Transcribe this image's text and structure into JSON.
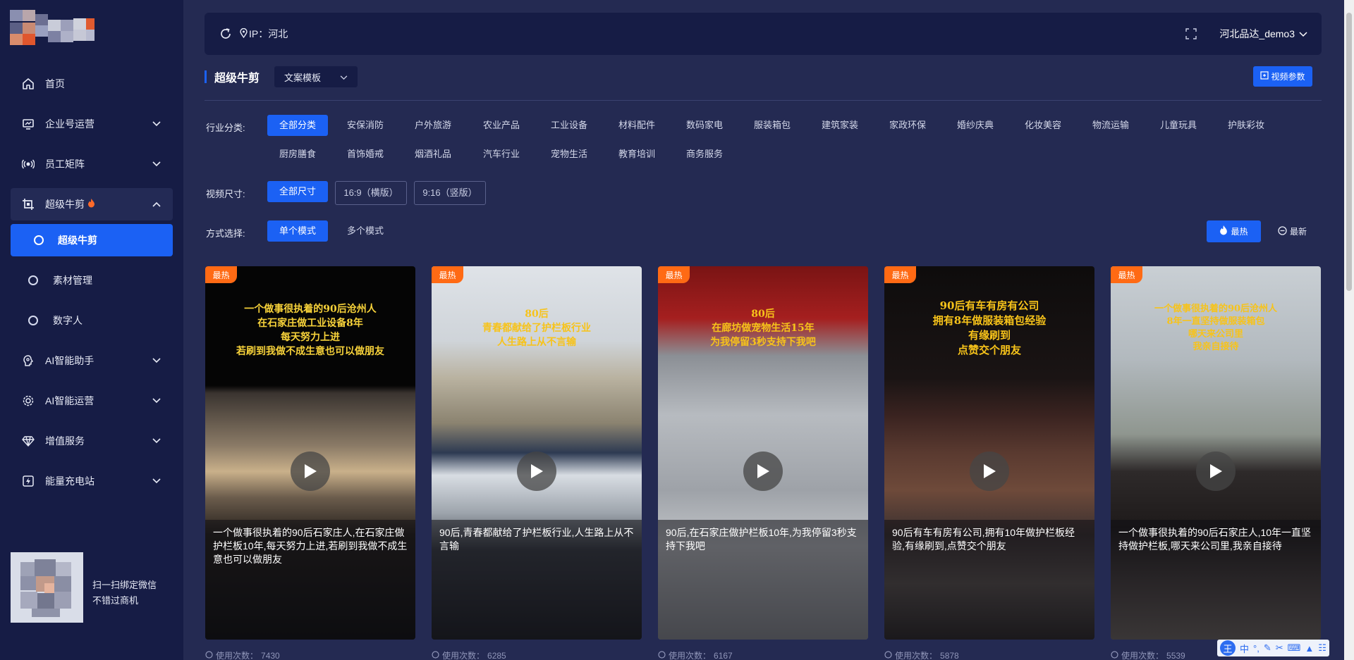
{
  "topbar": {
    "ip_label": "IP：河北",
    "user_name": "河北品达_demo3"
  },
  "sidebar": {
    "items": [
      {
        "label": "首页",
        "icon": "home-icon"
      },
      {
        "label": "企业号运营",
        "icon": "monitor-icon"
      },
      {
        "label": "员工矩阵",
        "icon": "broadcast-icon"
      },
      {
        "label": "超级牛剪",
        "icon": "crop-icon",
        "badge_icon": "flame-icon"
      },
      {
        "label": "超级牛剪",
        "icon": "ring-icon",
        "active": true
      },
      {
        "label": "素材管理",
        "icon": "ring-icon"
      },
      {
        "label": "数字人",
        "icon": "ring-icon"
      },
      {
        "label": "AI智能助手",
        "icon": "brain-icon"
      },
      {
        "label": "AI智能运营",
        "icon": "ai-gear-icon"
      },
      {
        "label": "增值服务",
        "icon": "diamond-icon"
      },
      {
        "label": "能量充电站",
        "icon": "lightning-icon"
      }
    ],
    "qr_text_line1": "扫一扫绑定微信",
    "qr_text_line2": "不错过商机"
  },
  "page": {
    "title": "超级牛剪",
    "template_select": "文案模板",
    "video_params_button": "视频参数"
  },
  "filters": {
    "industry_label": "行业分类:",
    "industries_row1": [
      "全部分类",
      "安保消防",
      "户外旅游",
      "农业产品",
      "工业设备",
      "材料配件",
      "数码家电",
      "服装箱包",
      "建筑家装",
      "家政环保",
      "婚纱庆典",
      "化妆美容",
      "物流运输",
      "儿童玩具",
      "护肤彩妆"
    ],
    "industries_row2": [
      "厨房膳食",
      "首饰婚戒",
      "烟酒礼品",
      "汽车行业",
      "宠物生活",
      "教育培训",
      "商务服务"
    ],
    "size_label": "视频尺寸:",
    "sizes": [
      "全部尺寸",
      "16:9（横版）",
      "9:16（竖版）"
    ],
    "mode_label": "方式选择:",
    "modes": [
      "单个模式",
      "多个模式"
    ],
    "sort_hot": "最热",
    "sort_new": "最新"
  },
  "cards": [
    {
      "badge": "最热",
      "caption": "一个做事很执着的90后沧州人\n在石家庄做工业设备8年\n每天努力上进\n若刷到我做不成生意也可以做朋友",
      "description": "一个做事很执着的90后石家庄人,在石家庄做护栏板10年,每天努力上进,若刷到我做不成生意也可以做朋友",
      "usage_label": "使用次数：",
      "usage_count": "7430"
    },
    {
      "badge": "最热",
      "caption": "80后\n青春都献给了护栏板行业\n人生路上从不言输",
      "description": "90后,青春都献给了护栏板行业,人生路上从不言输",
      "usage_label": "使用次数：",
      "usage_count": "6285"
    },
    {
      "badge": "最热",
      "caption": "80后\n在廊坊做宠物生活15年\n为我停留3秒支持下我吧",
      "description": "90后,在石家庄做护栏板10年,为我停留3秒支持下我吧",
      "usage_label": "使用次数：",
      "usage_count": "6167"
    },
    {
      "badge": "最热",
      "caption": "90后有车有房有公司\n拥有8年做服装箱包经验\n有缘刷到\n点赞交个朋友",
      "description": "90后有车有房有公司,拥有10年做护栏板经验,有缘刷到,点赞交个朋友",
      "usage_label": "使用次数：",
      "usage_count": "5878"
    },
    {
      "badge": "最热",
      "caption": "一个做事很执着的90后沧州人\n8年一直坚持做服装箱包\n哪天来公司里\n我亲自接待",
      "description": "一个做事很执着的90后石家庄人,10年一直坚持做护栏板,哪天来公司里,我亲自接待",
      "usage_label": "使用次数：",
      "usage_count": "5539"
    }
  ],
  "ime": {
    "logo": "王",
    "lang": "中"
  },
  "colors": {
    "accent": "#1b61f4",
    "sidebar_bg": "#161c45",
    "page_bg": "#242a52",
    "hot_badge": "#ff6a14",
    "caption_yellow": "#f7d23a"
  }
}
